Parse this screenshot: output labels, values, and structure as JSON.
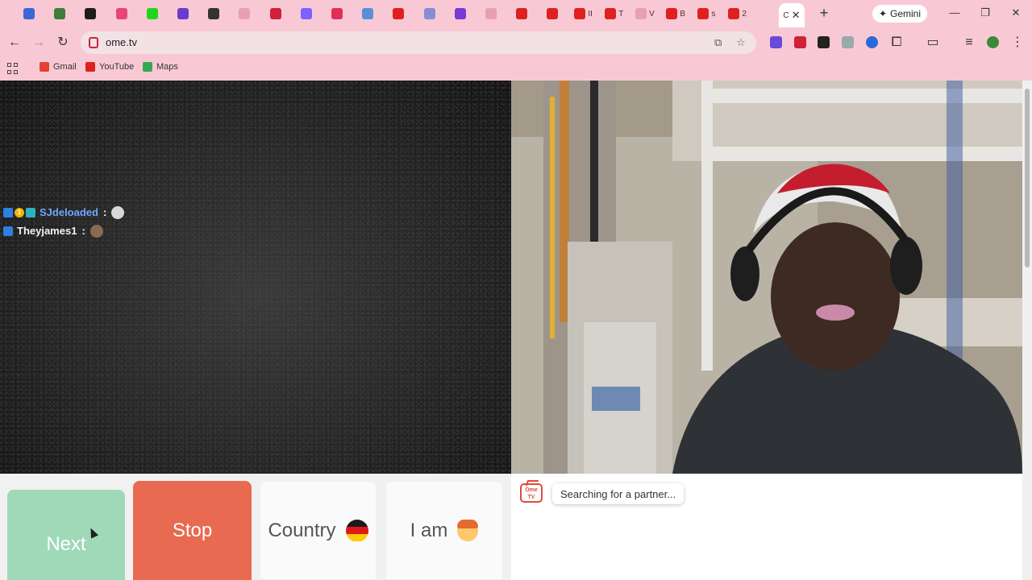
{
  "browser": {
    "tabs": [
      {
        "icon": "ticktick-icon",
        "color": "#3b66d8",
        "text": ""
      },
      {
        "icon": "shield-icon",
        "color": "#3f7d3a",
        "text": ""
      },
      {
        "icon": "terminal-icon",
        "color": "#1d1d1d",
        "text": ""
      },
      {
        "icon": "link-icon",
        "color": "#e8457a",
        "text": ""
      },
      {
        "icon": "kick-icon",
        "color": "#1fd61f",
        "text": ""
      },
      {
        "icon": "notes-icon",
        "color": "#6a3ad0",
        "text": ""
      },
      {
        "icon": "arrow-icon",
        "color": "#333333",
        "text": ""
      },
      {
        "icon": "sparkle-icon",
        "color": "#e8a0b0",
        "text": ""
      },
      {
        "icon": "block-icon",
        "color": "#d0203a",
        "text": ""
      },
      {
        "icon": "cloud-icon",
        "color": "#7b61ff",
        "text": ""
      },
      {
        "icon": "download-icon",
        "color": "#e0305a",
        "text": ""
      },
      {
        "icon": "plugin-icon",
        "color": "#5a8fd8",
        "text": ""
      },
      {
        "icon": "youtube-icon",
        "color": "#e02020",
        "text": ""
      },
      {
        "icon": "puzzle-icon",
        "color": "#8a8ad8",
        "text": ""
      },
      {
        "icon": "messenger-icon",
        "color": "#7a3ad8",
        "text": ""
      },
      {
        "icon": "circle-icon",
        "color": "#e8a0b0",
        "text": ""
      },
      {
        "icon": "youtube-icon",
        "color": "#e02020",
        "text": ""
      },
      {
        "icon": "youtube-icon",
        "color": "#e02020",
        "text": ""
      },
      {
        "icon": "youtube-icon",
        "color": "#e02020",
        "text": "II"
      },
      {
        "icon": "youtube-icon",
        "color": "#e02020",
        "text": "T"
      },
      {
        "icon": "heart-icon",
        "color": "#e8a0b0",
        "text": "V"
      },
      {
        "icon": "youtube-icon",
        "color": "#e02020",
        "text": "B"
      },
      {
        "icon": "youtube-icon",
        "color": "#e02020",
        "text": "s"
      },
      {
        "icon": "youtube-icon",
        "color": "#e02020",
        "text": "2"
      }
    ],
    "active_tab_text": "C",
    "gemini_label": "Gemini",
    "url": "ome.tv",
    "bookmarks": [
      {
        "label": "Gmail",
        "color": "#e44134"
      },
      {
        "label": "YouTube",
        "color": "#e02020"
      },
      {
        "label": "Maps",
        "color": "#34a853"
      }
    ]
  },
  "stranger_chat": [
    {
      "username": "SJdeloaded",
      "color": "#6ea8ff",
      "badges": [
        "#2f7fe0",
        "#f0b400",
        "#2fb0c0"
      ],
      "badge_text": [
        "",
        "1",
        ""
      ]
    },
    {
      "username": "Theyjames1",
      "color": "#f2f2f2",
      "badges": [
        "#2f7fe0"
      ],
      "badge_text": [
        ""
      ]
    }
  ],
  "controls": {
    "next_label": "Next",
    "stop_label": "Stop",
    "country_label": "Country",
    "iam_label": "I am"
  },
  "status": {
    "logo_text": "Ome TV",
    "message": "Searching for a partner..."
  },
  "colors": {
    "chrome_pink": "#f8c9d4",
    "next_green": "#9fd9b8",
    "stop_red": "#e86a50"
  }
}
